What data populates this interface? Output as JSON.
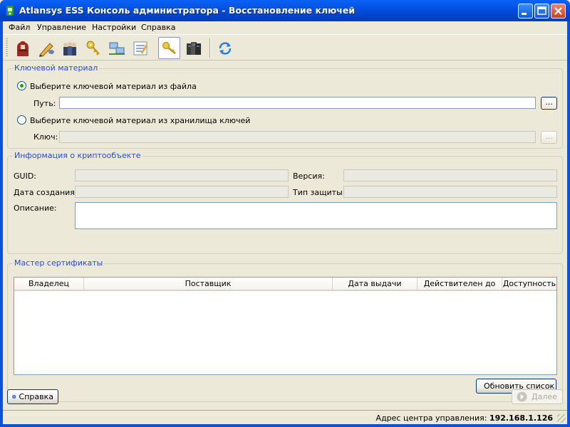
{
  "window": {
    "title": "Atlansys ESS Консоль администратора - Восстановление ключей"
  },
  "menu": [
    "Файл",
    "Управление",
    "Настройки",
    "Справка"
  ],
  "toolbar": {
    "icons": [
      "user-icon",
      "pen-icon",
      "users-icon",
      "keys-icon",
      "network-icon",
      "list-icon",
      "key-restore-icon",
      "servers-icon",
      "refresh-icon"
    ],
    "active": "key-restore-icon"
  },
  "keyMaterial": {
    "legend": "Ключевой материал",
    "fromFileLabel": "Выберите ключевой материал из файла",
    "pathLabel": "Путь:",
    "pathValue": "",
    "browse": "...",
    "fromStoreLabel": "Выберите ключевой материал из хранилища ключей",
    "keyLabel": "Ключ:",
    "keyValue": "",
    "selected": "file"
  },
  "cryptoInfo": {
    "legend": "Информация о криптообъекте",
    "guidLabel": "GUID:",
    "versionLabel": "Версия:",
    "createdLabel": "Дата создания:",
    "protectionLabel": "Тип защиты:",
    "descriptionLabel": "Описание:"
  },
  "certs": {
    "legend": "Мастер сертификаты",
    "columns": [
      "Владелец",
      "Поставщик",
      "Дата выдачи",
      "Действителен до",
      "Доступность"
    ],
    "rows": [],
    "refreshButton": "Обновить список"
  },
  "footer": {
    "helpButton": "Справка",
    "nextButton": "Далее"
  },
  "status": {
    "label": "Адрес центра управления:",
    "address": "192.168.1.126"
  },
  "colors": {
    "titlebar": "#0453e3",
    "groupLegend": "#2a4bcc",
    "face": "#ece9d8"
  }
}
